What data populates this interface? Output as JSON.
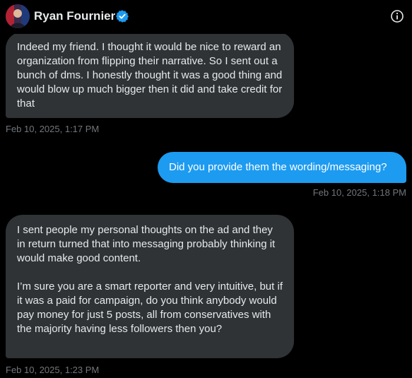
{
  "header": {
    "display_name": "Ryan Fournier",
    "verified": true,
    "avatar_icon": "user-avatar-icon",
    "info_icon": "info-icon"
  },
  "colors": {
    "background": "#000000",
    "received_bubble": "#2f3336",
    "sent_bubble": "#1d9bf0",
    "verified_badge": "#1d9bf0",
    "timestamp": "#71767b",
    "text": "#e7e9ea"
  },
  "messages": [
    {
      "direction": "received",
      "paragraphs": [
        "Indeed my friend. I thought it would be nice to reward an organization from flipping their narrative. So I sent out a bunch of dms. I honestly thought it was a good thing and would blow up much bigger then it did and take credit for that"
      ],
      "timestamp": "Feb 10, 2025, 1:17 PM"
    },
    {
      "direction": "sent",
      "paragraphs": [
        "Did you provide them the wording/messaging?"
      ],
      "timestamp": "Feb 10, 2025, 1:18 PM"
    },
    {
      "direction": "received",
      "paragraphs": [
        "I sent people my personal thoughts on the ad and they in return turned that into messaging probably thinking it would make good content.",
        "I’m sure you are a smart reporter and very intuitive, but if it was a paid for campaign, do you think anybody would pay money for just 5 posts, all from conservatives with the majority having less followers then you?"
      ],
      "timestamp": "Feb 10, 2025, 1:23 PM"
    }
  ]
}
